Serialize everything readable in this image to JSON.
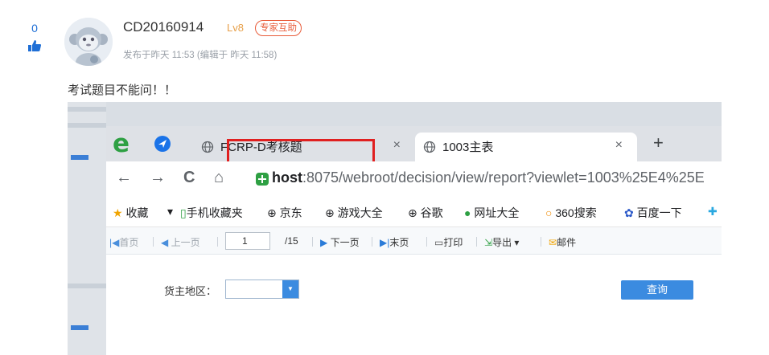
{
  "post": {
    "vote_count": "0",
    "username": "CD20160914",
    "level": "Lv8",
    "badge": "专家互助",
    "meta": "发布于昨天 11:53 (编辑于 昨天 11:58)",
    "text": "考试题目不能问！！"
  },
  "browser": {
    "tabs": [
      {
        "title": "FCRP-D考核题",
        "close": "×"
      },
      {
        "title": "1003主表",
        "close": "×"
      }
    ],
    "new_tab": "+",
    "nav": {
      "back": "←",
      "forward": "→",
      "reload": "C",
      "home": "⌂"
    },
    "url_host": "host",
    "url_rest": ":8075/webroot/decision/view/report?viewlet=1003%25E4%25E",
    "bookmarks": [
      "收藏",
      "▾",
      "手机收藏夹",
      "京东",
      "游戏大全",
      "谷歌",
      "网址大全",
      "360搜索",
      "百度一下"
    ]
  },
  "report_toolbar": {
    "first": "首页",
    "prev": "上一页",
    "page": "1",
    "total": "/15",
    "next": "下一页",
    "last": "末页",
    "print": "打印",
    "export": "导出 ▾",
    "mail": "邮件"
  },
  "form": {
    "label": "货主地区：",
    "query_button": "查询"
  },
  "colors": {
    "accent": "#1f6fd6",
    "level": "#e7a04a",
    "badge": "#e85c3a",
    "highlight": "#e02020"
  }
}
